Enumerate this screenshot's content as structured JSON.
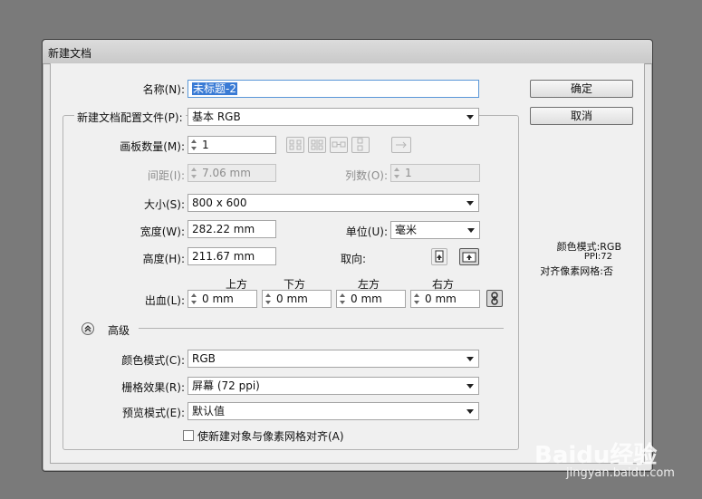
{
  "dialog": {
    "title": "新建文档",
    "ok_label": "确定",
    "cancel_label": "取消"
  },
  "form": {
    "name_label": "名称(N):",
    "name_value": "未标题-2",
    "profile_label": "新建文档配置文件(P):",
    "profile_value": "基本 RGB",
    "artboards_label": "画板数量(M):",
    "artboards_value": "1",
    "spacing_label": "间距(I):",
    "spacing_value": "7.06 mm",
    "columns_label": "列数(O):",
    "columns_value": "1",
    "size_label": "大小(S):",
    "size_value": "800 x 600",
    "width_label": "宽度(W):",
    "width_value": "282.22 mm",
    "units_label": "单位(U):",
    "units_value": "毫米",
    "height_label": "高度(H):",
    "height_value": "211.67 mm",
    "orientation_label": "取向:",
    "bleed_label": "出血(L):",
    "bleed_top_label": "上方",
    "bleed_bottom_label": "下方",
    "bleed_left_label": "左方",
    "bleed_right_label": "右方",
    "bleed_top_value": "0 mm",
    "bleed_bottom_value": "0 mm",
    "bleed_left_value": "0 mm",
    "bleed_right_value": "0 mm"
  },
  "advanced": {
    "title": "高级",
    "color_mode_label": "颜色模式(C):",
    "color_mode_value": "RGB",
    "raster_label": "栅格效果(R):",
    "raster_value": "屏幕 (72 ppi)",
    "preview_label": "预览模式(E):",
    "preview_value": "默认值",
    "align_pixel_label": "使新建对象与像素网格对齐(A)"
  },
  "info": {
    "color_mode": "颜色模式:RGB",
    "ppi": "PPI:72",
    "align_grid": "对齐像素网格:否"
  },
  "watermark": {
    "brand": "Baidu经验",
    "url": "jingyan.baidu.com"
  },
  "colors": {
    "selection": "#3a7bd5",
    "dialog_bg": "#f0f0f0",
    "desktop": "#7a7a7a"
  }
}
